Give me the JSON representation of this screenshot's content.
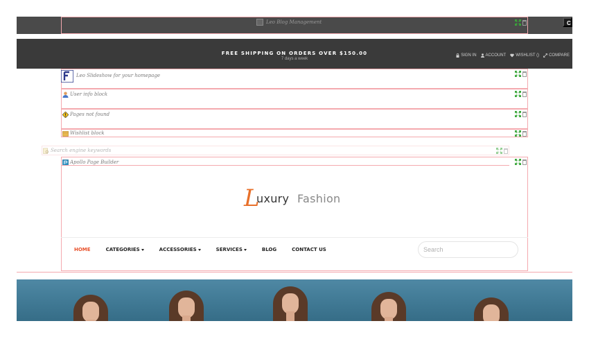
{
  "window": {
    "close_label": "Close"
  },
  "blog_module": {
    "label": "Leo Blog Management"
  },
  "topbar": {
    "shipping": "FREE SHIPPING ON ORDERS OVER $150.00",
    "days": "7 days a week",
    "links": {
      "sign_in": "SIGN IN",
      "account": "ACCOUNT",
      "wishlist": "WISHLIST ()",
      "compare": "COMPARE"
    }
  },
  "modules": [
    {
      "label": "Leo Slideshow for your homepage",
      "icon": "leo-slideshow-icon"
    },
    {
      "label": "User info block",
      "icon": "user-icon"
    },
    {
      "label": "Pages not found",
      "icon": "warning-icon"
    },
    {
      "label": "Wishlist block",
      "icon": "wishlist-box-icon"
    },
    {
      "label": "Search engine keywords",
      "icon": "search-keywords-icon"
    },
    {
      "label": "Apollo Page Builder",
      "icon": "page-builder-icon"
    }
  ],
  "logo": {
    "initial": "L",
    "part1": "uxury",
    "part2": "Fashion"
  },
  "menu": {
    "items": [
      {
        "label": "HOME",
        "active": true,
        "dropdown": false
      },
      {
        "label": "CATEGORIES",
        "active": false,
        "dropdown": true
      },
      {
        "label": "ACCESSORIES",
        "active": false,
        "dropdown": true
      },
      {
        "label": "SERVICES",
        "active": false,
        "dropdown": true
      },
      {
        "label": "BLOG",
        "active": false,
        "dropdown": false
      },
      {
        "label": "CONTACT US",
        "active": false,
        "dropdown": false
      }
    ]
  },
  "search": {
    "placeholder": "Search"
  },
  "colors": {
    "accent": "#e8502a",
    "logo_orange": "#e8702a",
    "topbar_bg": "#3a3a3a",
    "outline": "#f4a9ae",
    "move_green": "#3aa63a"
  }
}
